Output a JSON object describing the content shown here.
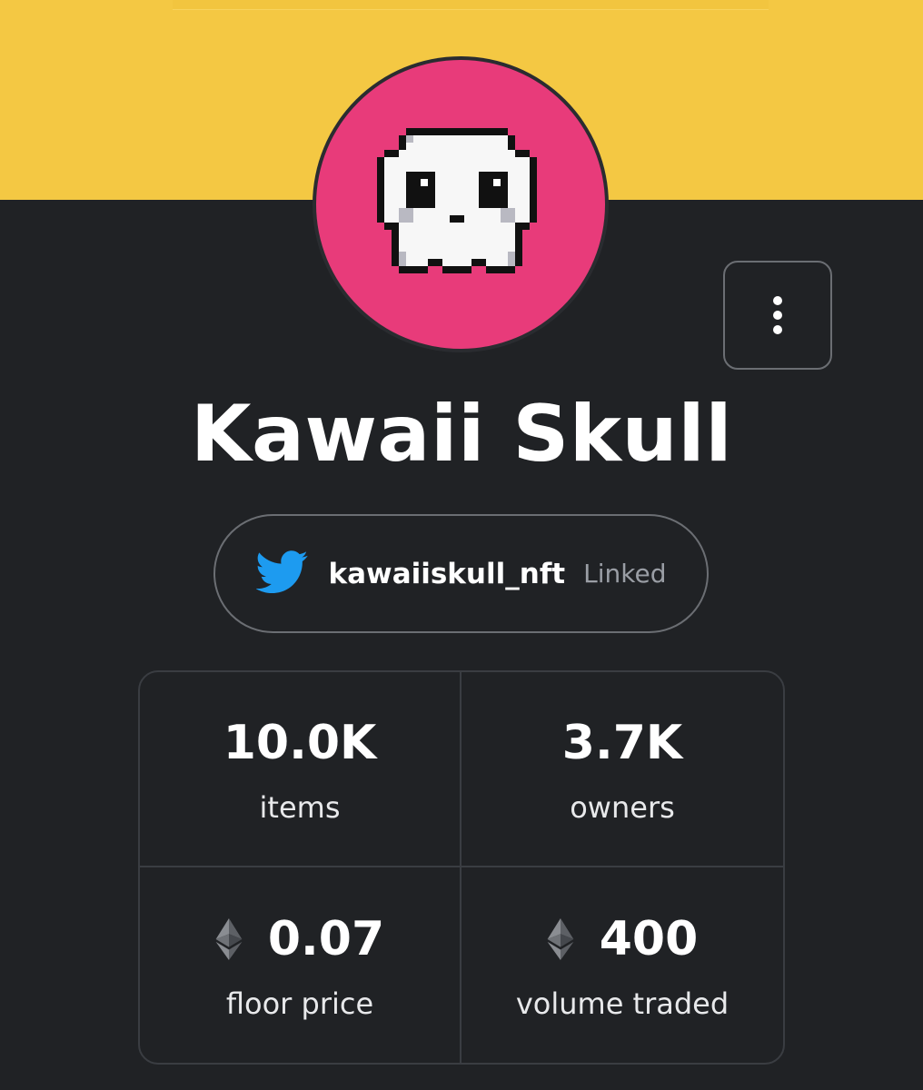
{
  "collection": {
    "name": "Kawaii Skull",
    "avatar_icon": "pixel-skull-icon",
    "avatar_bg": "#e83b7a",
    "banner_color": "#f4c843"
  },
  "menu": {
    "more_icon": "more-vertical-icon"
  },
  "twitter": {
    "icon": "twitter-bird-icon",
    "handle": "kawaiiskull_nft",
    "status": "Linked",
    "accent": "#1d9bf0"
  },
  "stats": [
    {
      "value": "10.0K",
      "label": "items"
    },
    {
      "value": "3.7K",
      "label": "owners"
    },
    {
      "value": "0.07",
      "label": "floor price",
      "icon": "ethereum-icon"
    },
    {
      "value": "400",
      "label": "volume traded",
      "icon": "ethereum-icon"
    }
  ]
}
